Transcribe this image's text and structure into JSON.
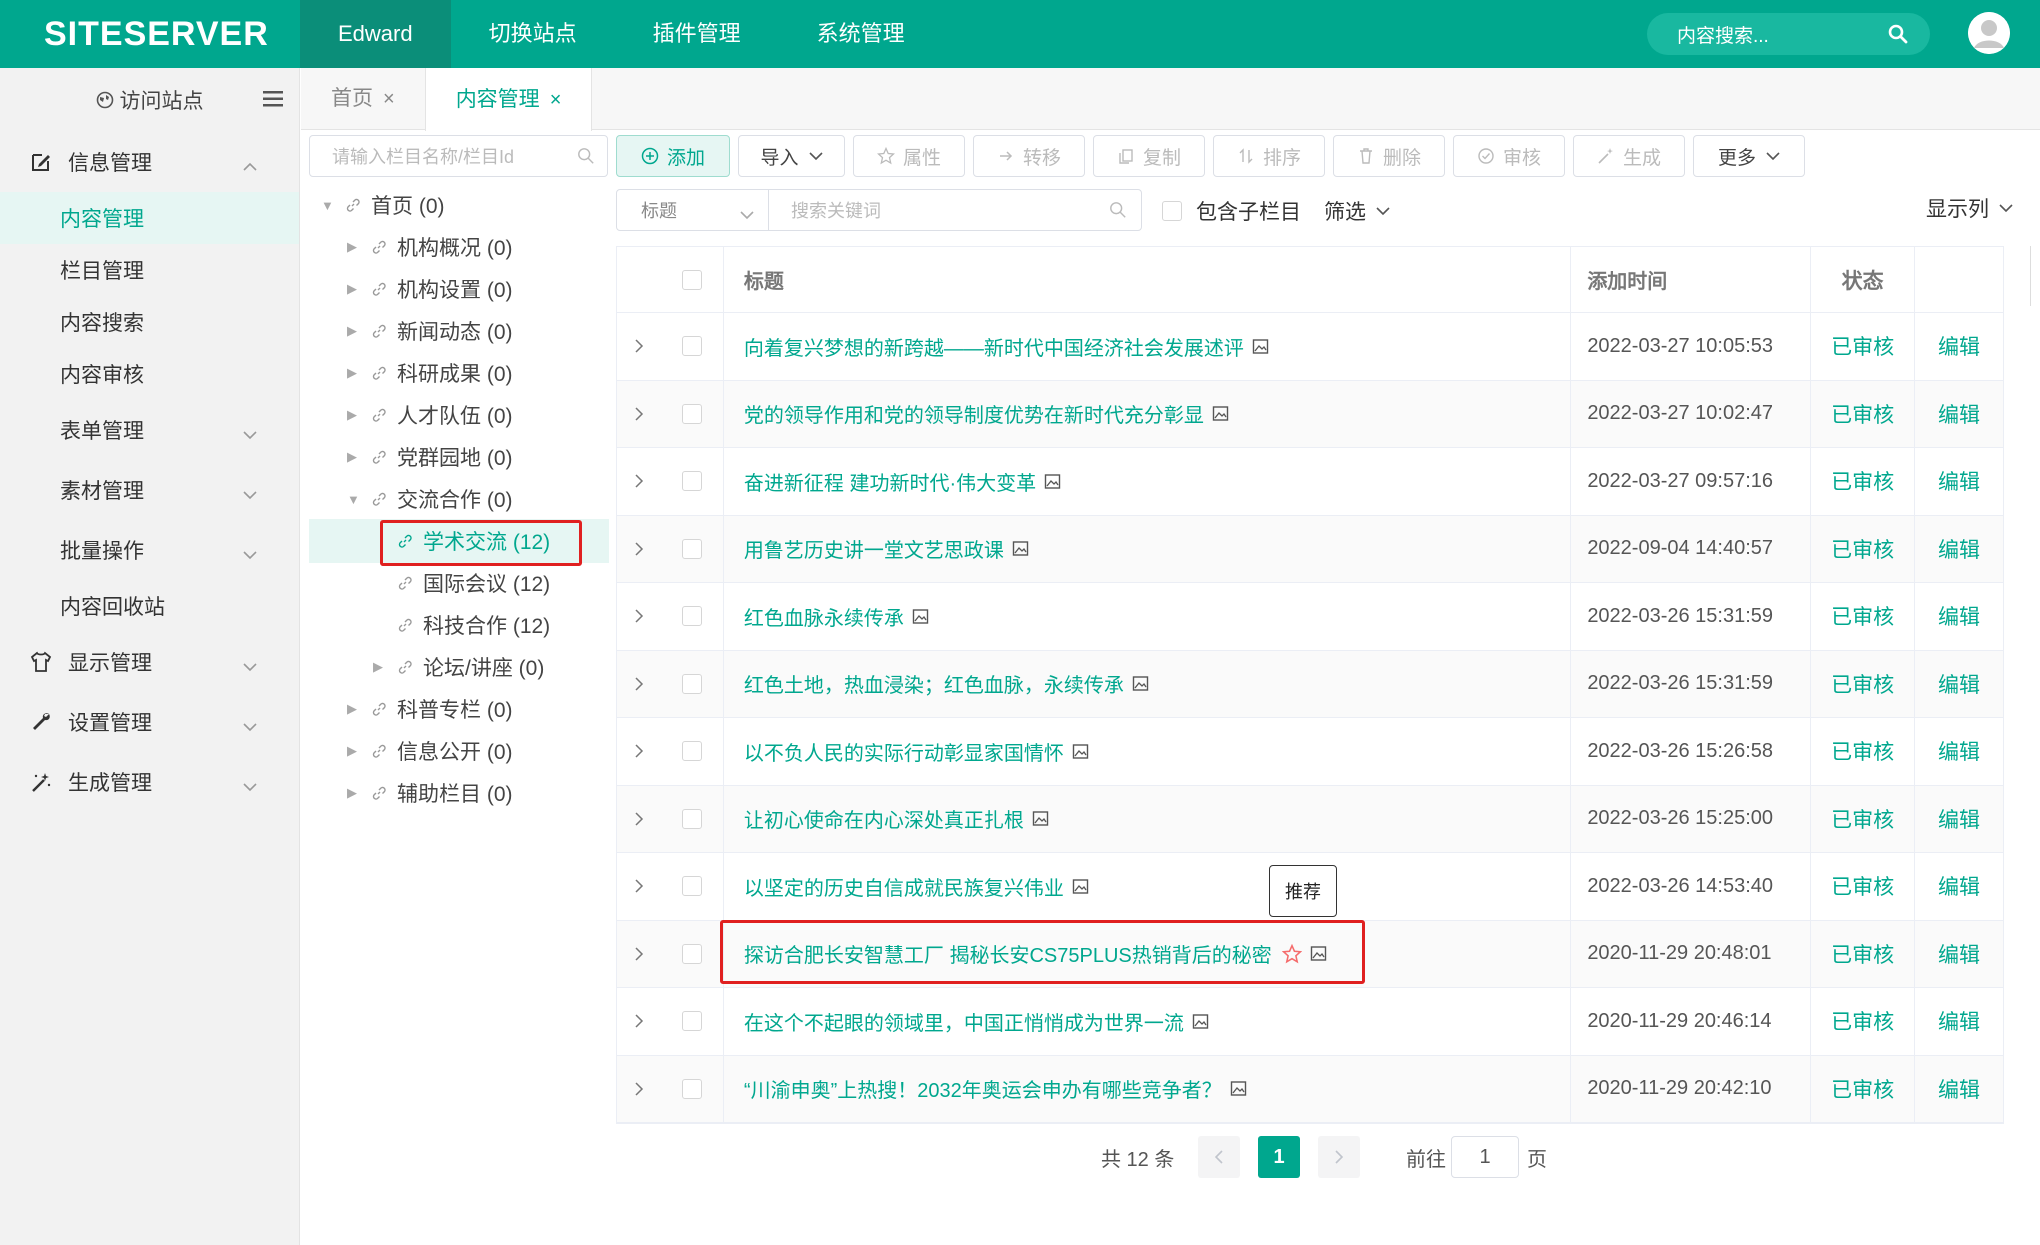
{
  "brand": {
    "logo_text": "SITESERVER",
    "accent": "#00a78e"
  },
  "topnav": [
    {
      "label": "Edward",
      "active": true
    },
    {
      "label": "切换站点"
    },
    {
      "label": "插件管理"
    },
    {
      "label": "系统管理"
    }
  ],
  "top_search": {
    "placeholder": "内容搜索..."
  },
  "sidebar": {
    "visit_label": "访问站点",
    "groups": [
      {
        "label": "信息管理",
        "icon": "edit-icon",
        "expanded": true,
        "items": [
          {
            "label": "内容管理",
            "active": true
          },
          {
            "label": "栏目管理"
          },
          {
            "label": "内容搜索"
          },
          {
            "label": "内容审核"
          },
          {
            "label": "表单管理",
            "has_children": true
          },
          {
            "label": "素材管理",
            "has_children": true
          },
          {
            "label": "批量操作",
            "has_children": true
          },
          {
            "label": "内容回收站"
          }
        ]
      },
      {
        "label": "显示管理",
        "icon": "shirt-icon"
      },
      {
        "label": "设置管理",
        "icon": "wrench-icon"
      },
      {
        "label": "生成管理",
        "icon": "magic-wand-icon"
      }
    ]
  },
  "tabs": [
    {
      "label": "首页",
      "close": "×"
    },
    {
      "label": "内容管理",
      "close": "×",
      "active": true
    }
  ],
  "tree": {
    "search_placeholder": "请输入栏目名称/栏目Id",
    "nodes": [
      {
        "label": "首页 (0)"
      },
      {
        "label": "机构概况 (0)"
      },
      {
        "label": "机构设置 (0)"
      },
      {
        "label": "新闻动态 (0)"
      },
      {
        "label": "科研成果 (0)"
      },
      {
        "label": "人才队伍 (0)"
      },
      {
        "label": "党群园地 (0)"
      },
      {
        "label": "交流合作 (0)"
      },
      {
        "label": "学术交流 (12)"
      },
      {
        "label": "国际会议 (12)"
      },
      {
        "label": "科技合作 (12)"
      },
      {
        "label": "论坛/讲座 (0)"
      },
      {
        "label": "科普专栏 (0)"
      },
      {
        "label": "信息公开 (0)"
      },
      {
        "label": "辅助栏目 (0)"
      }
    ]
  },
  "toolbar": {
    "add": "添加",
    "import": "导入",
    "attributes": "属性",
    "transfer": "转移",
    "copy": "复制",
    "sort": "排序",
    "delete": "删除",
    "audit": "审核",
    "generate": "生成",
    "more": "更多"
  },
  "filter": {
    "field": "标题",
    "keyword_placeholder": "搜索关键词",
    "include_children": "包含子栏目",
    "filter_label": "筛选",
    "columns_label": "显示列"
  },
  "table": {
    "headers": {
      "title": "标题",
      "time": "添加时间",
      "status": "状态"
    },
    "rows": [
      {
        "title": "向着复兴梦想的新跨越——新时代中国经济社会发展述评",
        "time": "2022-03-27 10:05:53",
        "status": "已审核",
        "action": "编辑"
      },
      {
        "title": "党的领导作用和党的领导制度优势在新时代充分彰显",
        "time": "2022-03-27 10:02:47",
        "status": "已审核",
        "action": "编辑"
      },
      {
        "title": "奋进新征程 建功新时代·伟大变革",
        "time": "2022-03-27 09:57:16",
        "status": "已审核",
        "action": "编辑"
      },
      {
        "title": "用鲁艺历史讲一堂文艺思政课",
        "time": "2022-09-04 14:40:57",
        "status": "已审核",
        "action": "编辑"
      },
      {
        "title": "红色血脉永续传承",
        "time": "2022-03-26 15:31:59",
        "status": "已审核",
        "action": "编辑"
      },
      {
        "title": "红色土地，热血浸染；红色血脉，永续传承",
        "time": "2022-03-26 15:31:59",
        "status": "已审核",
        "action": "编辑"
      },
      {
        "title": "以不负人民的实际行动彰显家国情怀",
        "time": "2022-03-26 15:26:58",
        "status": "已审核",
        "action": "编辑"
      },
      {
        "title": "让初心使命在内心深处真正扎根",
        "time": "2022-03-26 15:25:00",
        "status": "已审核",
        "action": "编辑"
      },
      {
        "title": "以坚定的历史自信成就民族复兴伟业",
        "time": "2022-03-26 14:53:40",
        "status": "已审核",
        "action": "编辑"
      },
      {
        "title": "探访合肥长安智慧工厂 揭秘长安CS75PLUS热销背后的秘密",
        "time": "2020-11-29 20:48:01",
        "status": "已审核",
        "action": "编辑",
        "recommended": true
      },
      {
        "title": "在这个不起眼的领域里，中国正悄悄成为世界一流",
        "time": "2020-11-29 20:46:14",
        "status": "已审核",
        "action": "编辑"
      },
      {
        "title": "“川渝申奥”上热搜！2032年奥运会申办有哪些竞争者？",
        "time": "2020-11-29 20:42:10",
        "status": "已审核",
        "action": "编辑"
      }
    ]
  },
  "tooltip": "推荐",
  "pagination": {
    "total": "共 12 条",
    "current": "1",
    "goto_label": "前往",
    "goto_value": "1",
    "page_suffix": "页"
  }
}
